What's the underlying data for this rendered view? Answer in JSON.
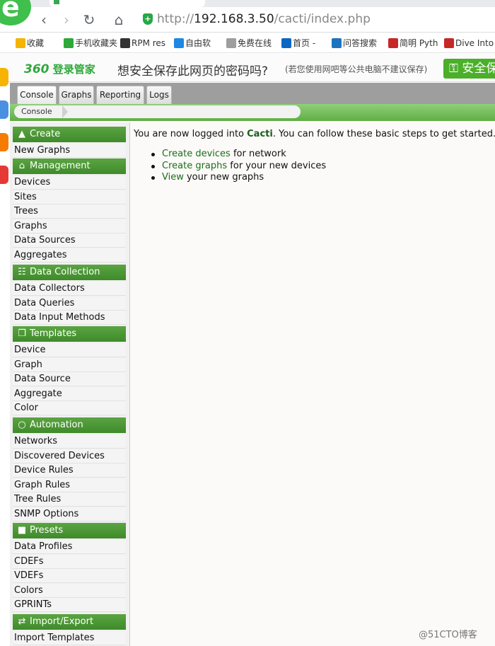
{
  "browser": {
    "url_prefix": "http://",
    "url_host": "192.168.3.50",
    "url_path": "/cacti/index.php",
    "accent": "#3fbf4b"
  },
  "bookmarks": [
    {
      "label": "收藏",
      "icon": "star-icon",
      "color": "#f4b400"
    },
    {
      "label": "手机收藏夹",
      "icon": "phone-icon",
      "color": "#2fa83a"
    },
    {
      "label": "RPM res",
      "icon": "penguin-icon",
      "color": "#333333"
    },
    {
      "label": "自由软",
      "icon": "ubuntu-icon",
      "color": "#1e88e5"
    },
    {
      "label": "免费在线",
      "icon": "page-icon",
      "color": "#9e9e9e"
    },
    {
      "label": "首页 -",
      "icon": "zhihu-icon",
      "color": "#0a66c2"
    },
    {
      "label": "问答搜索",
      "icon": "s-icon",
      "color": "#1e73be"
    },
    {
      "label": "简明 Pyth",
      "icon": "book-icon",
      "color": "#c62828"
    },
    {
      "label": "Dive Into",
      "icon": "book-icon",
      "color": "#c62828"
    }
  ],
  "password_bar": {
    "brand_num": "360",
    "brand_text": "登录管家",
    "question": "想安全保存此网页的密码吗?",
    "note": "(若您使用网吧等公共电脑不建议保存)",
    "save_label": "安全保"
  },
  "tabs": [
    {
      "label": "Console"
    },
    {
      "label": "Graphs"
    },
    {
      "label": "Reporting"
    },
    {
      "label": "Logs"
    }
  ],
  "breadcrumb": "Console",
  "sidebar": {
    "create": {
      "label": "Create",
      "items": [
        "New Graphs"
      ]
    },
    "management": {
      "label": "Management",
      "items": [
        "Devices",
        "Sites",
        "Trees",
        "Graphs",
        "Data Sources",
        "Aggregates"
      ]
    },
    "data_collection": {
      "label": "Data Collection",
      "items": [
        "Data Collectors",
        "Data Queries",
        "Data Input Methods"
      ]
    },
    "templates": {
      "label": "Templates",
      "items": [
        "Device",
        "Graph",
        "Data Source",
        "Aggregate",
        "Color"
      ]
    },
    "automation": {
      "label": "Automation",
      "items": [
        "Networks",
        "Discovered Devices",
        "Device Rules",
        "Graph Rules",
        "Tree Rules",
        "SNMP Options"
      ]
    },
    "presets": {
      "label": "Presets",
      "items": [
        "Data Profiles",
        "CDEFs",
        "VDEFs",
        "Colors",
        "GPRINTs"
      ]
    },
    "import_export": {
      "label": "Import/Export",
      "items": [
        "Import Templates"
      ]
    }
  },
  "main": {
    "welcome_prefix": "You are now logged into ",
    "welcome_app": "Cacti",
    "welcome_suffix": ". You can follow these basic steps to get started.",
    "steps": [
      {
        "link": "Create devices",
        "rest": " for network"
      },
      {
        "link": "Create graphs",
        "rest": " for your new devices"
      },
      {
        "link": "View",
        "rest": " your new graphs"
      }
    ]
  },
  "watermark": "@51CTO博客"
}
